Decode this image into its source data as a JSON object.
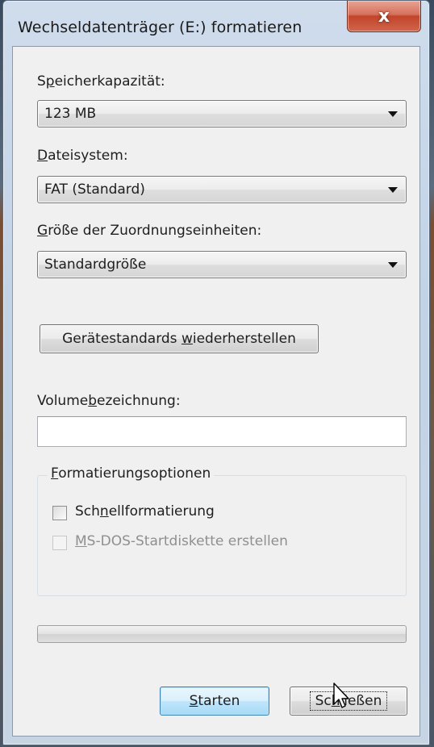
{
  "window": {
    "title": "Wechseldatenträger (E:) formatieren",
    "close_symbol": "x",
    "close_icon": "close-icon"
  },
  "capacity": {
    "label_pre": "S",
    "label_ul": "p",
    "label_post": "eicherkapazität:",
    "value": "123 MB"
  },
  "filesystem": {
    "label_pre": "",
    "label_ul": "D",
    "label_post": "ateisystem:",
    "value": "FAT (Standard)"
  },
  "allocation": {
    "label_pre": "",
    "label_ul": "G",
    "label_post": "röße der Zuordnungseinheiten:",
    "value": "Standardgröße"
  },
  "restore_button": {
    "label_pre": "Gerätestandards ",
    "label_ul": "w",
    "label_post": "iederherstellen"
  },
  "volume_label": {
    "label_pre": "Volume",
    "label_ul": "b",
    "label_post": "ezeichnung:",
    "value": ""
  },
  "options": {
    "legend_pre": "",
    "legend_ul": "F",
    "legend_post": "ormatierungsoptionen",
    "quick_format": {
      "label_pre": "Sch",
      "label_ul": "n",
      "label_post": "ellformatierung",
      "checked": false
    },
    "msdos_startup": {
      "label_pre": "",
      "label_ul": "M",
      "label_post": "S-DOS-Startdiskette erstellen",
      "checked": false,
      "enabled": false
    }
  },
  "progress": {
    "value": 0
  },
  "buttons": {
    "start_pre": "",
    "start_ul": "S",
    "start_post": "tarten",
    "close_pre": "Sc",
    "close_ul": "h",
    "close_post": "ließen"
  },
  "colors": {
    "close_button_red": "#c1442a",
    "dialog_background": "#f0f0f0",
    "default_button_blue": "#3c7fb1"
  }
}
